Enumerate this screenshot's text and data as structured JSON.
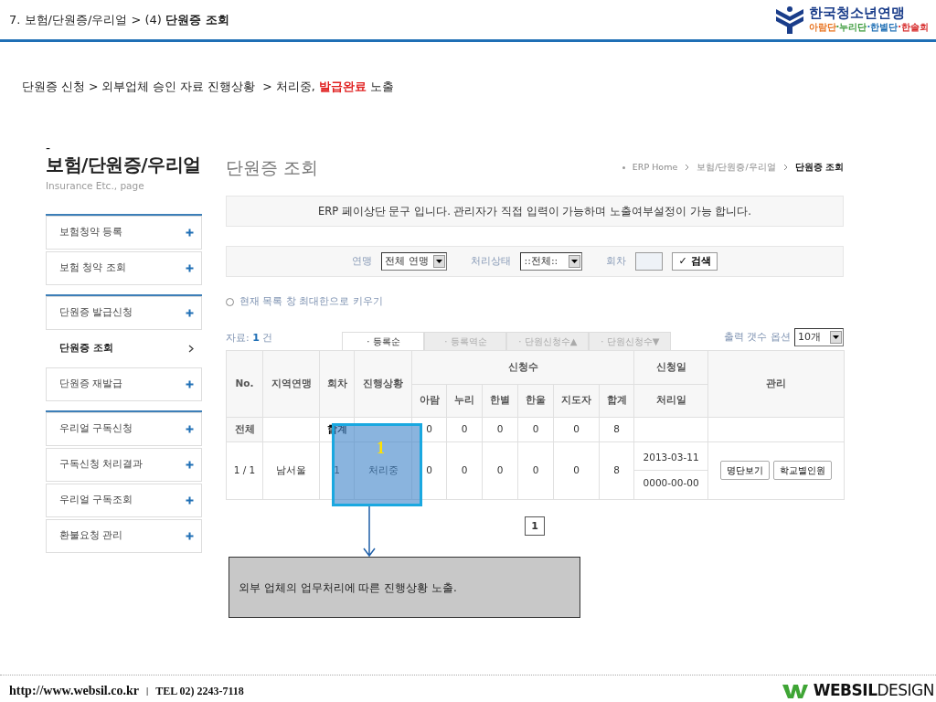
{
  "header": {
    "title": "7. 보험/단원증/우리얼 > (4) **단원증 조회**",
    "logo": {
      "name": "한국청소년연맹",
      "tagline": [
        {
          "text": "아람단",
          "color": "#e8731f"
        },
        {
          "text": "·누리단",
          "color": "#3a9a3a"
        },
        {
          "text": "·한별단",
          "color": "#1f6fb5"
        },
        {
          "text": "·한솔회",
          "color": "#d62b2b"
        }
      ]
    }
  },
  "description": {
    "prefix": "단원증 신청 > 외부업체 승인 자료 진행상황  > 처리중, ",
    "highlight": "발급완료",
    "suffix": " 노출"
  },
  "sidebar": {
    "dash": "-",
    "title": "보험/단원증/우리얼",
    "subtitle": "Insurance Etc., page",
    "groups": [
      {
        "items": [
          {
            "label": "보험청약 등록",
            "selected": false
          },
          {
            "label": "보험 청약 조회",
            "selected": false
          }
        ]
      },
      {
        "items": [
          {
            "label": "단원증 발급신청",
            "selected": false
          },
          {
            "label": "단원증 조회",
            "selected": true
          },
          {
            "label": "단원증 재발급",
            "selected": false
          }
        ]
      },
      {
        "items": [
          {
            "label": "우리얼 구독신청",
            "selected": false
          },
          {
            "label": "구독신청 처리결과",
            "selected": false
          },
          {
            "label": "우리얼 구독조회",
            "selected": false
          },
          {
            "label": "환불요청 관리",
            "selected": false
          }
        ]
      }
    ]
  },
  "content": {
    "title": "단원증 조회",
    "breadcrumb": [
      "ERP Home",
      "보험/단원증/우리얼",
      "단원증 조회"
    ],
    "notice": "ERP 페이상단 문구 입니다. 관리자가 직접 입력이 가능하며 노출여부설정이 가능 합니다.",
    "filters": {
      "union_label": "연맹",
      "union_value": "전체 연맹",
      "status_label": "처리상태",
      "status_value": "::전체::",
      "round_label": "회차",
      "search_button": "✓ 검색"
    },
    "maximize": {
      "label": "현재 목록 창 최대한으로 키우기",
      "checked": false
    },
    "count": {
      "label": "자료: ",
      "value": "1",
      "unit": " 건"
    },
    "sort_tabs": [
      {
        "label": "· 등록순",
        "selected": true
      },
      {
        "label": "· 등록역순",
        "selected": false
      },
      {
        "label": "· 단원신청수▲",
        "selected": false
      },
      {
        "label": "· 단원신청수▼",
        "selected": false
      }
    ],
    "page_size": {
      "label": "출력 갯수 옵션",
      "value": "10개"
    },
    "table": {
      "columns": [
        "No.",
        "지역연맹",
        "회차",
        "진행상황"
      ],
      "group_header": "신청수",
      "sub_columns": [
        "아람",
        "누리",
        "한별",
        "한울",
        "지도자",
        "합계"
      ],
      "date_headers": [
        "신청일",
        "처리일"
      ],
      "manage_header": "관리",
      "total_row": {
        "label": "전체",
        "title": "합계",
        "counts": [
          "0",
          "0",
          "0",
          "0",
          "0",
          "8"
        ]
      },
      "rows": [
        {
          "no": "1 / 1",
          "region": "남서울",
          "round": "1",
          "status": "처리중",
          "counts": [
            "0",
            "0",
            "0",
            "0",
            "0",
            "8"
          ],
          "apply_date": "2013-03-11",
          "process_date": "0000-00-00",
          "buttons": [
            "명단보기",
            "학교별인원"
          ]
        }
      ]
    },
    "pages": [
      {
        "label": "1",
        "selected": true
      }
    ]
  },
  "annotation": {
    "number": "1",
    "note": "외부 업체의 업무처리에 따른 진행상황 노출."
  },
  "footer": {
    "url": "http://www.websil.co.kr",
    "separator": "|",
    "tel": "TEL 02) 2243-7118",
    "brand": "**WEBSIL**DESIGN"
  }
}
